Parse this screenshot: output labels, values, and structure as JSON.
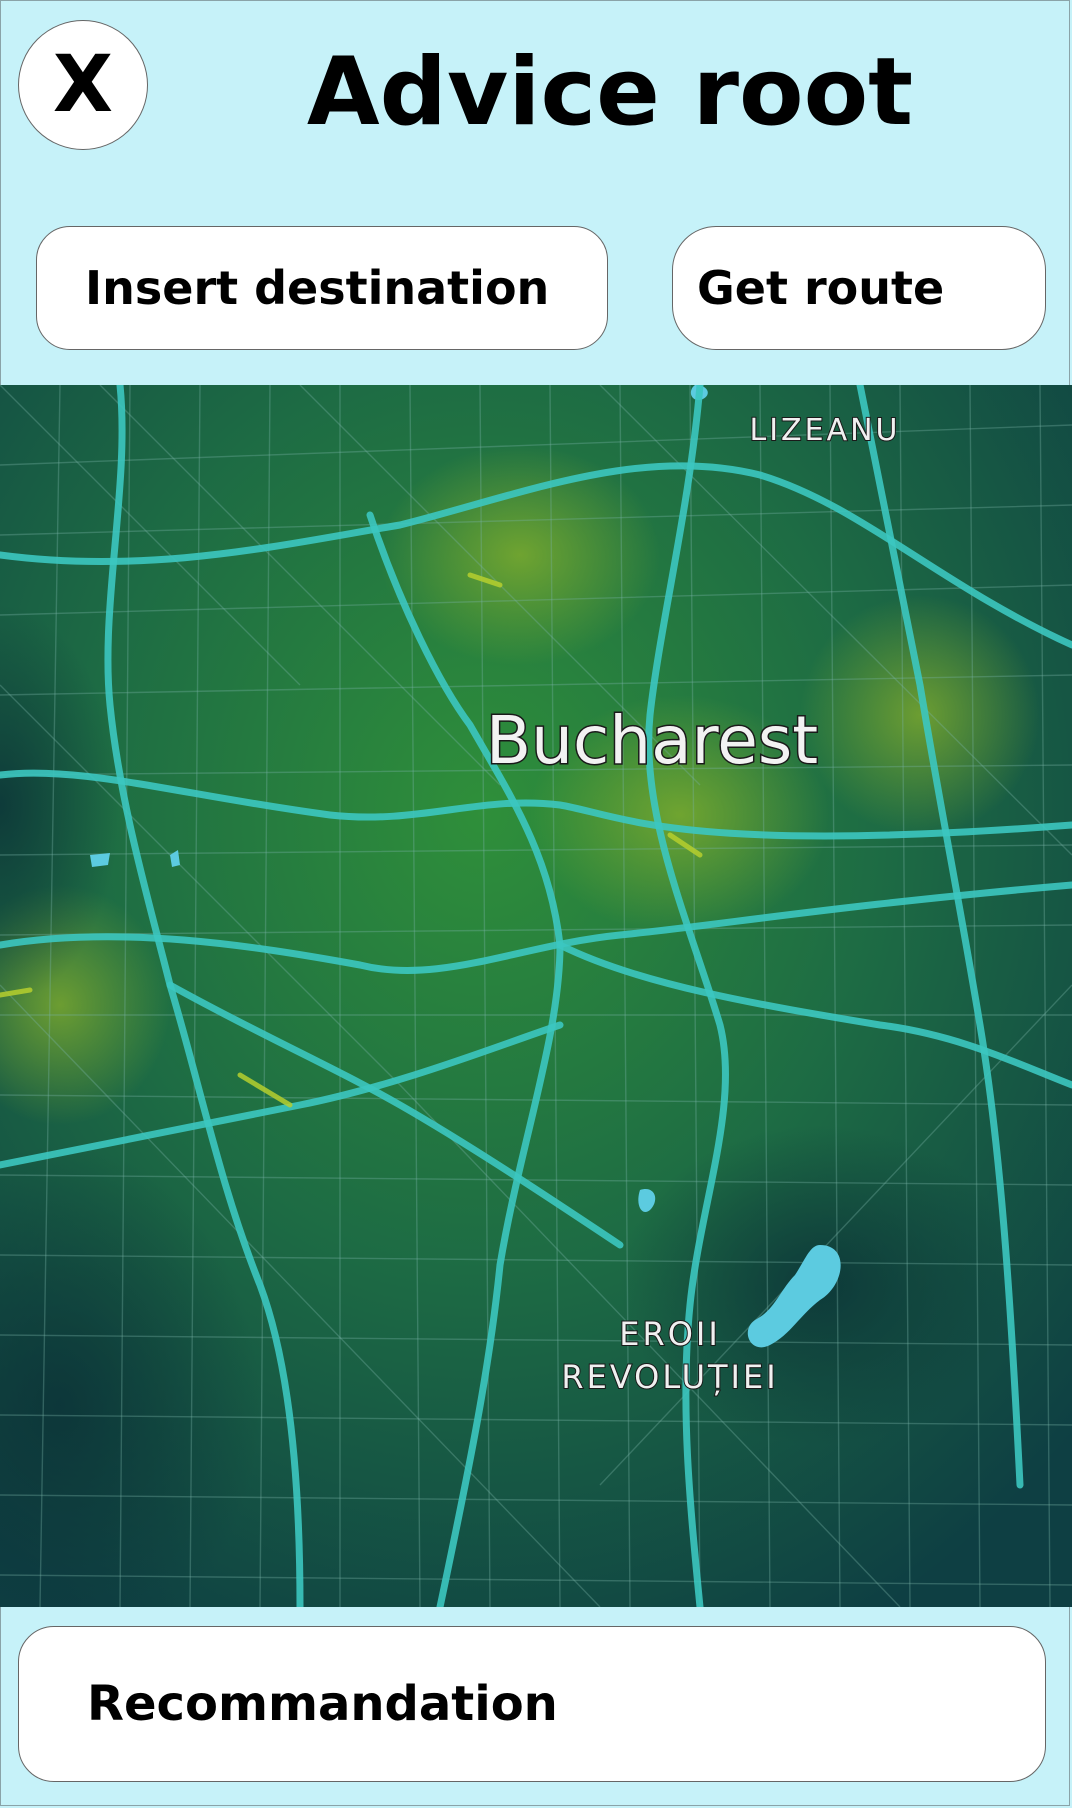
{
  "header": {
    "close_label": "X",
    "title": "Advice root"
  },
  "controls": {
    "destination_label": "Insert destination",
    "get_route_label": "Get route"
  },
  "map": {
    "city_label": "Bucharest",
    "district_north": "LIZEANU",
    "district_south_line1": "EROII",
    "district_south_line2": "REVOLUȚIEI",
    "colors": {
      "base_dark": "#0f4a45",
      "base_green": "#1f7a3a",
      "road_main": "#3cc6c0",
      "road_minor": "#6aa9a0",
      "water": "#5ccbe0",
      "hotspot": "#b6cf2e"
    }
  },
  "footer": {
    "recommendation_label": "Recommandation"
  },
  "theme": {
    "background": "#c6f2f9",
    "button_bg": "#ffffff"
  }
}
